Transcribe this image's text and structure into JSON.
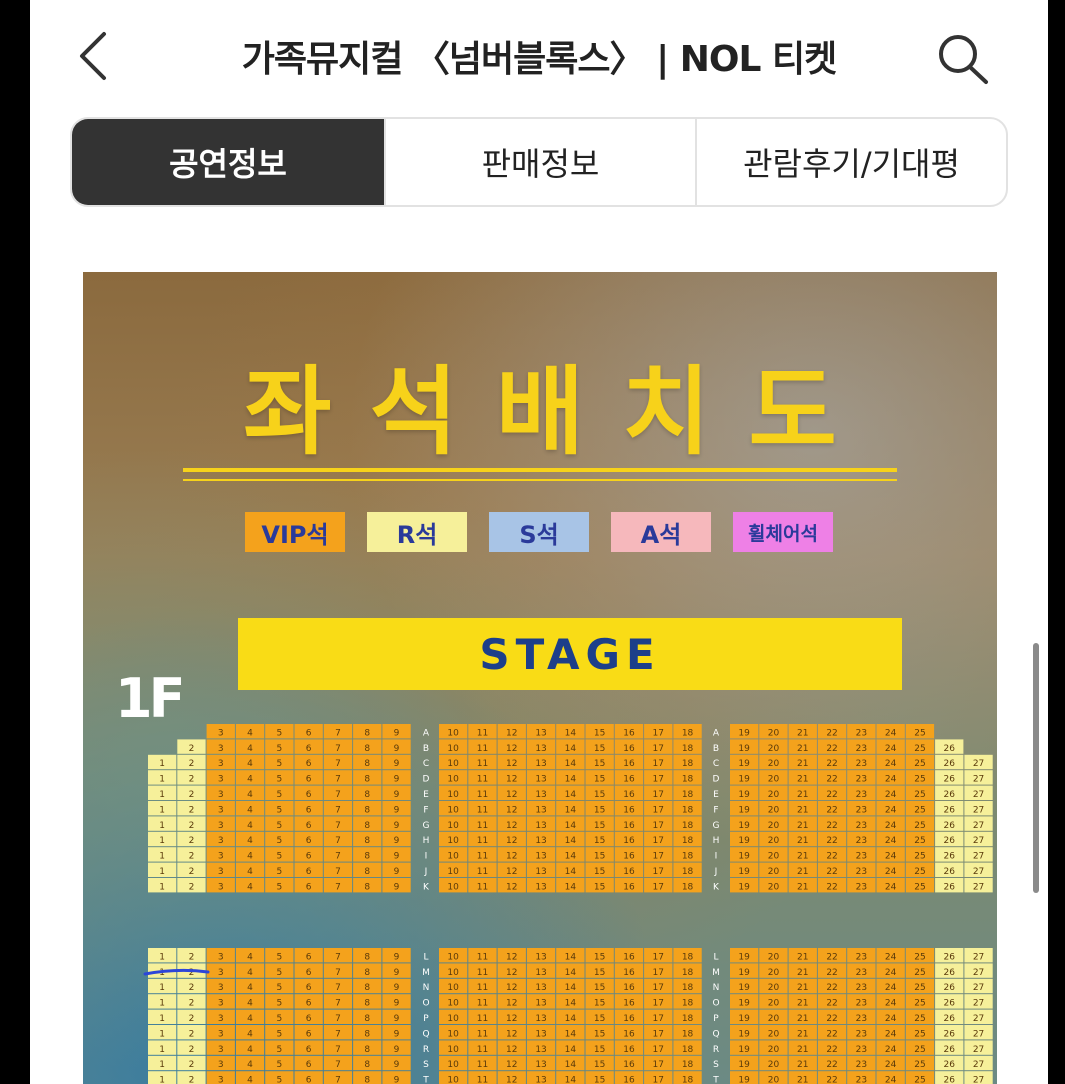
{
  "header": {
    "title": "가족뮤지컬 〈넘버블록스〉 | NOL 티켓",
    "back_icon": "chevron-left-icon",
    "search_icon": "search-icon"
  },
  "tabs": [
    {
      "label": "공연정보",
      "active": true
    },
    {
      "label": "판매정보",
      "active": false
    },
    {
      "label": "관람후기/기대평",
      "active": false
    }
  ],
  "poster": {
    "title": "좌석배치도",
    "legend": [
      {
        "label": "VIP석",
        "color": "#f4a21c"
      },
      {
        "label": "R석",
        "color": "#f6f09a"
      },
      {
        "label": "S석",
        "color": "#a8c4e6"
      },
      {
        "label": "A석",
        "color": "#f6b8bc"
      },
      {
        "label": "휠체어석",
        "color": "#ee80e6"
      }
    ],
    "stage_label": "STAGE",
    "floor_label": "1F",
    "row_letters_top": [
      "A",
      "B",
      "C",
      "D",
      "E",
      "F",
      "G",
      "H",
      "I",
      "J",
      "K"
    ],
    "row_letters_bottom": [
      "L",
      "M",
      "N",
      "O",
      "P",
      "Q",
      "R",
      "S",
      "T"
    ]
  }
}
